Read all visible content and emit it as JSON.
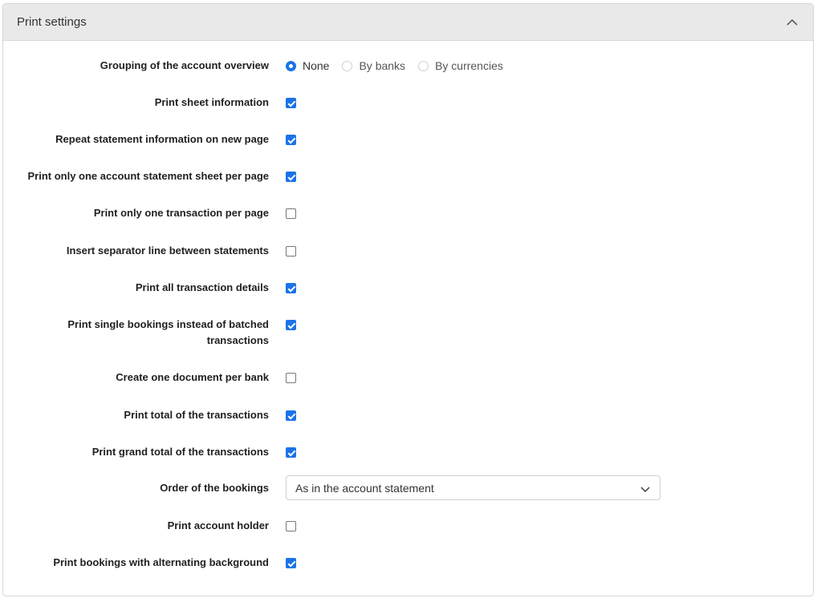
{
  "panel": {
    "title": "Print settings"
  },
  "grouping": {
    "label": "Grouping of the account overview",
    "options": [
      {
        "label": "None",
        "selected": true
      },
      {
        "label": "By banks",
        "selected": false
      },
      {
        "label": "By currencies",
        "selected": false
      }
    ]
  },
  "settings": [
    {
      "label": "Print sheet information",
      "checked": true
    },
    {
      "label": "Repeat statement information on new page",
      "checked": true
    },
    {
      "label": "Print only one account statement sheet per page",
      "checked": true
    },
    {
      "label": "Print only one transaction per page",
      "checked": false
    },
    {
      "label": "Insert separator line between statements",
      "checked": false
    },
    {
      "label": "Print all transaction details",
      "checked": true
    },
    {
      "label": "Print single bookings instead of batched transactions",
      "checked": true
    },
    {
      "label": "Create one document per bank",
      "checked": false
    },
    {
      "label": "Print total of the transactions",
      "checked": true
    },
    {
      "label": "Print grand total of the transactions",
      "checked": true
    }
  ],
  "order": {
    "label": "Order of the bookings",
    "value": "As in the account statement"
  },
  "settings_after": [
    {
      "label": "Print account holder",
      "checked": false
    },
    {
      "label": "Print bookings with alternating background",
      "checked": true
    }
  ],
  "colors": {
    "accent": "#1a73e8",
    "header_bg": "#e9e9e9"
  }
}
